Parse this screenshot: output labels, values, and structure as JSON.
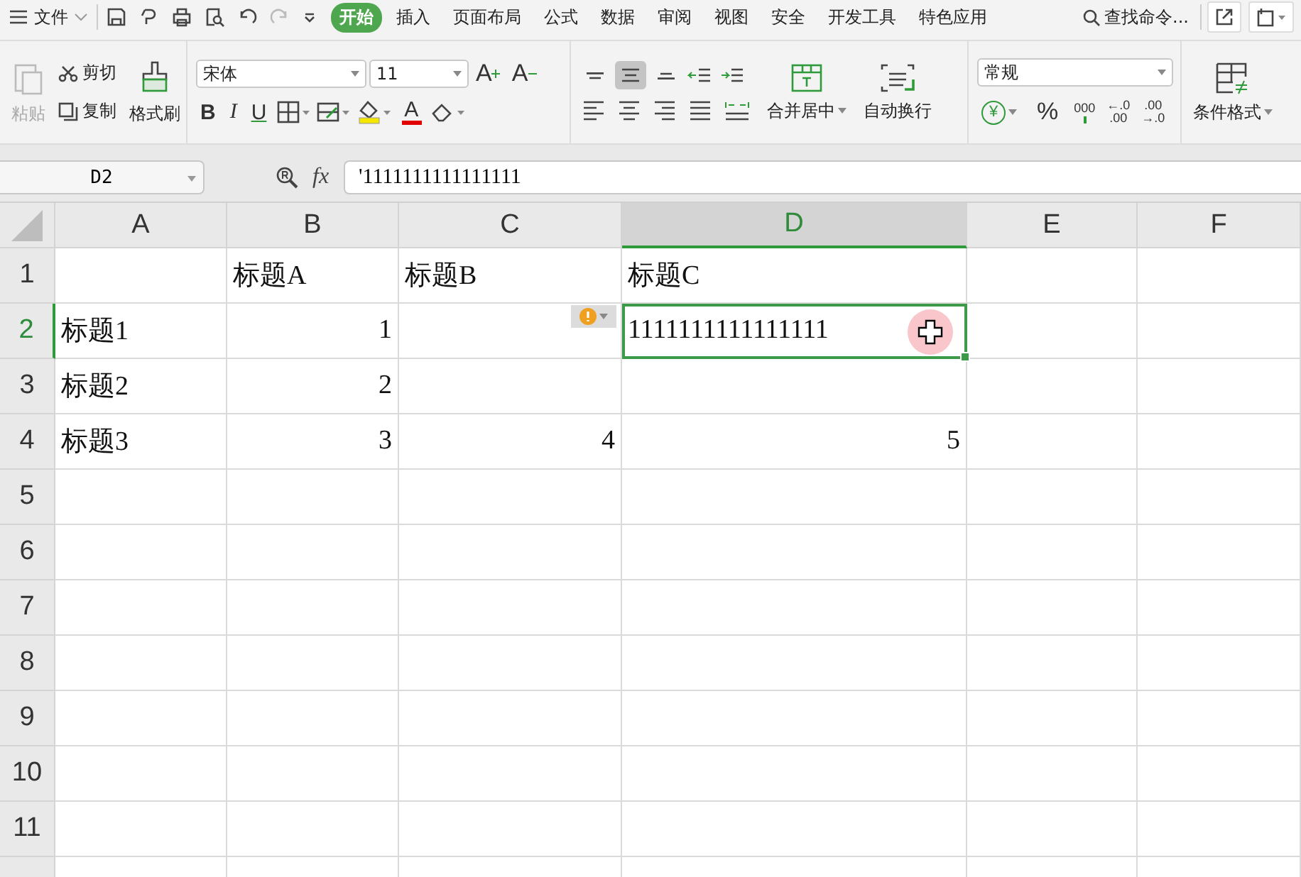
{
  "menubar": {
    "file": "文件",
    "tabs": [
      {
        "label": "开始",
        "selected": true
      },
      {
        "label": "插入",
        "selected": false
      },
      {
        "label": "页面布局",
        "selected": false
      },
      {
        "label": "公式",
        "selected": false
      },
      {
        "label": "数据",
        "selected": false
      },
      {
        "label": "审阅",
        "selected": false
      },
      {
        "label": "视图",
        "selected": false
      },
      {
        "label": "安全",
        "selected": false
      },
      {
        "label": "开发工具",
        "selected": false
      },
      {
        "label": "特色应用",
        "selected": false
      }
    ],
    "search": "查找命令..."
  },
  "ribbon": {
    "clipboard": {
      "paste": {
        "label": "粘贴",
        "disabled": true
      },
      "cut": "剪切",
      "copy": "复制",
      "format_painter": "格式刷"
    },
    "font": {
      "name": "宋体",
      "size": "11",
      "size_buttons": [
        {
          "label": "A",
          "kind": "grow"
        },
        {
          "label": "A",
          "kind": "shrink"
        }
      ],
      "style_buttons": [
        {
          "label": "B",
          "kind": "bold"
        },
        {
          "label": "I",
          "kind": "italic"
        },
        {
          "label": "U",
          "kind": "underline"
        }
      ],
      "font_color": "A"
    },
    "alignment": {
      "vertical": [
        {
          "kind": "top",
          "selected": false
        },
        {
          "kind": "middle",
          "selected": true
        },
        {
          "kind": "bottom",
          "selected": false
        }
      ],
      "merge": "合并居中",
      "wrap": "自动换行"
    },
    "number": {
      "format": "常规",
      "currency": "¥",
      "percent": "%",
      "thousands": "000",
      "increase_decimal": [
        "←.0",
        ".00"
      ],
      "decrease_decimal": [
        ".00",
        "→.0"
      ]
    },
    "conditional_format": "条件格式"
  },
  "formula_bar": {
    "cell_ref": "D2",
    "fx": "fx",
    "value": "'1111111111111111"
  },
  "sheet": {
    "columns": [
      {
        "label": "A",
        "selected": false
      },
      {
        "label": "B",
        "selected": false
      },
      {
        "label": "C",
        "selected": false
      },
      {
        "label": "D",
        "selected": true
      },
      {
        "label": "E",
        "selected": false
      },
      {
        "label": "F",
        "selected": false
      }
    ],
    "rows": [
      {
        "label": "1",
        "selected": false,
        "cells": [
          {},
          {
            "text": "标题A",
            "kind": "text"
          },
          {
            "text": "标题B",
            "kind": "text"
          },
          {
            "text": "标题C",
            "kind": "text"
          },
          {},
          {}
        ]
      },
      {
        "label": "2",
        "selected": true,
        "cells": [
          {
            "text": "标题1",
            "kind": "text"
          },
          {
            "text": "1",
            "kind": "number"
          },
          {},
          {
            "text": "1111111111111111",
            "kind": "text",
            "active": true,
            "error_tag": true
          },
          {},
          {}
        ]
      },
      {
        "label": "3",
        "selected": false,
        "cells": [
          {
            "text": "标题2",
            "kind": "text"
          },
          {
            "text": "2",
            "kind": "number"
          },
          {},
          {},
          {},
          {}
        ]
      },
      {
        "label": "4",
        "selected": false,
        "cells": [
          {
            "text": "标题3",
            "kind": "text"
          },
          {
            "text": "3",
            "kind": "number"
          },
          {
            "text": "4",
            "kind": "number"
          },
          {
            "text": "5",
            "kind": "number"
          },
          {},
          {}
        ]
      },
      {
        "label": "5",
        "selected": false,
        "cells": [
          {},
          {},
          {},
          {},
          {},
          {}
        ]
      },
      {
        "label": "6",
        "selected": false,
        "cells": [
          {},
          {},
          {},
          {},
          {},
          {}
        ]
      },
      {
        "label": "7",
        "selected": false,
        "cells": [
          {},
          {},
          {},
          {},
          {},
          {}
        ]
      },
      {
        "label": "8",
        "selected": false,
        "cells": [
          {},
          {},
          {},
          {},
          {},
          {}
        ]
      },
      {
        "label": "9",
        "selected": false,
        "cells": [
          {},
          {},
          {},
          {},
          {},
          {}
        ]
      },
      {
        "label": "10",
        "selected": false,
        "cells": [
          {},
          {},
          {},
          {},
          {},
          {}
        ]
      },
      {
        "label": "11",
        "selected": false,
        "cells": [
          {},
          {},
          {},
          {},
          {},
          {}
        ]
      }
    ]
  }
}
